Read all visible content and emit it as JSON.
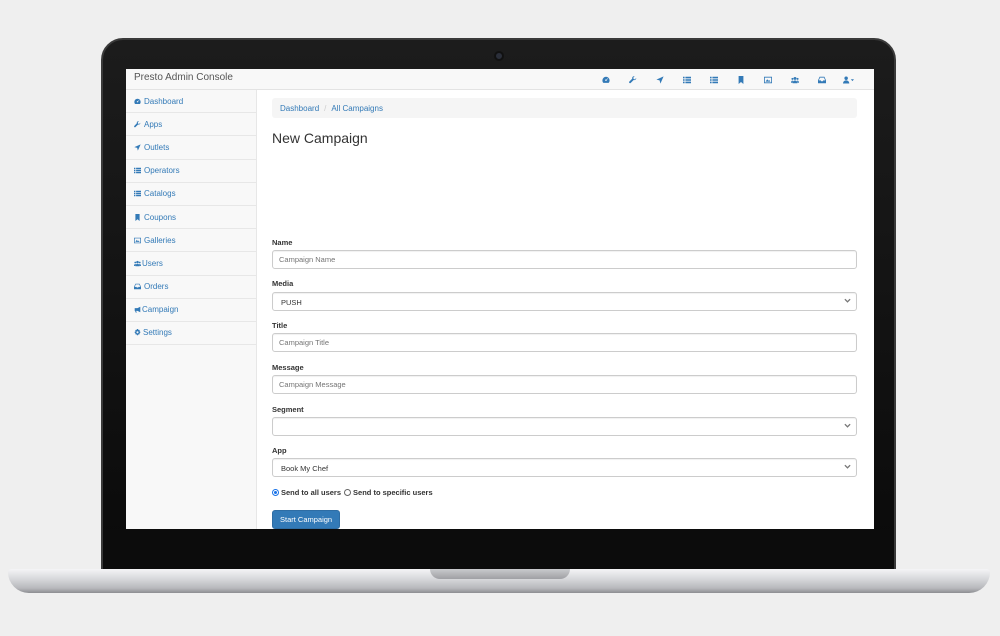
{
  "app": {
    "title": "Presto Admin Console"
  },
  "navbar": {
    "icons": [
      "dashboard-icon",
      "wrench-icon",
      "location-arrow-icon",
      "list-icon",
      "list-icon",
      "bookmark-icon",
      "image-icon",
      "users-icon",
      "inbox-icon",
      "user-icon"
    ]
  },
  "sidebar": {
    "items": [
      {
        "label": "Dashboard",
        "icon": "dashboard-icon"
      },
      {
        "label": "Apps",
        "icon": "wrench-icon"
      },
      {
        "label": "Outlets",
        "icon": "location-arrow-icon"
      },
      {
        "label": "Operators",
        "icon": "list-icon"
      },
      {
        "label": "Catalogs",
        "icon": "list-icon"
      },
      {
        "label": "Coupons",
        "icon": "bookmark-icon"
      },
      {
        "label": "Galleries",
        "icon": "image-icon"
      },
      {
        "label": "Users",
        "icon": "users-icon"
      },
      {
        "label": "Orders",
        "icon": "inbox-icon"
      },
      {
        "label": "Campaign",
        "icon": "bullhorn-icon"
      },
      {
        "label": "Settings",
        "icon": "gear-icon"
      }
    ]
  },
  "breadcrumb": {
    "items": [
      "Dashboard",
      "All Campaigns"
    ],
    "separator": "/"
  },
  "page": {
    "title": "New Campaign"
  },
  "form": {
    "name": {
      "label": "Name",
      "placeholder": "Campaign Name",
      "value": ""
    },
    "media": {
      "label": "Media",
      "value": "PUSH"
    },
    "title": {
      "label": "Title",
      "placeholder": "Campaign Title",
      "value": ""
    },
    "message": {
      "label": "Message",
      "placeholder": "Campaign Message",
      "value": ""
    },
    "segment": {
      "label": "Segment",
      "value": ""
    },
    "app": {
      "label": "App",
      "value": "Book My Chef"
    },
    "audience": {
      "options": [
        "Send to all users",
        "Send to specific users"
      ],
      "selected": "Send to all users"
    },
    "submit_label": "Start Campaign"
  },
  "colors": {
    "accent": "#337ab7",
    "navbar_bg": "#f8f8f8"
  }
}
